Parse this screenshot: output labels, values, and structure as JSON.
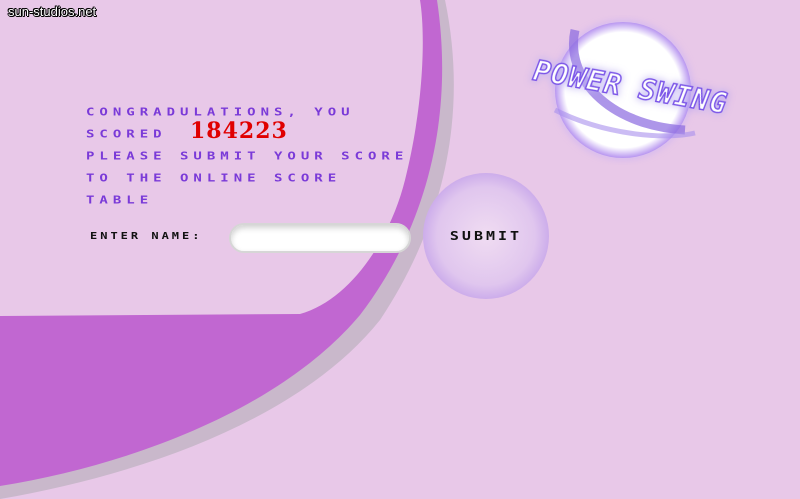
{
  "site": {
    "label": "sun-studios.net"
  },
  "message": {
    "line1": "CONGRADULATIONS, YOU",
    "line2": "SCORED",
    "line3": "PLEASE SUBMIT YOUR SCORE",
    "line4": "TO THE ONLINE SCORE",
    "line5": "TABLE"
  },
  "score": {
    "value": "184223"
  },
  "form": {
    "enter_label": "ENTER NAME:",
    "name_value": "",
    "submit_label": "SUBMIT"
  },
  "logo": {
    "text": "POWER SWING"
  },
  "colors": {
    "background": "#e8c8e8",
    "swoosh": "#c167d1",
    "text": "#7a3ad8",
    "score": "#e00000"
  }
}
